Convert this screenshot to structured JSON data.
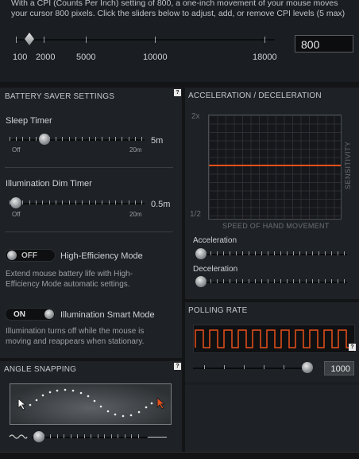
{
  "cpi": {
    "description": "With a CPI (Counts Per Inch) setting of 800, a one-inch movement of your mouse moves your cursor 800 pixels. Click the sliders below to adjust, add, or remove CPI levels (5 max)",
    "value": "800",
    "tick_labels": [
      "100",
      "2000",
      "5000",
      "10000",
      "18000"
    ]
  },
  "battery": {
    "header": "BATTERY SAVER SETTINGS",
    "help": "?",
    "sleep_label": "Sleep Timer",
    "sleep_value": "5m",
    "sleep_min": "Off",
    "sleep_max": "20m",
    "dim_label": "Illumination Dim Timer",
    "dim_value": "0.5m",
    "dim_min": "Off",
    "dim_max": "20m",
    "he_toggle": "OFF",
    "he_label": "High-Efficiency Mode",
    "he_desc": "Extend mouse battery life with High-Efficiency Mode automatic settings.",
    "smart_toggle": "ON",
    "smart_label": "Illumination Smart Mode",
    "smart_desc": "Illumination turns off while the mouse is moving and reappears when stationary."
  },
  "accel": {
    "header": "ACCELERATION / DECELERATION",
    "y_top": "2x",
    "y_bottom": "1/2",
    "y_axis": "SENSITIVITY",
    "x_axis": "SPEED OF HAND MOVEMENT",
    "accel_label": "Acceleration",
    "decel_label": "Deceleration",
    "line_color": "#e8501a"
  },
  "polling": {
    "header": "POLLING RATE",
    "help": "?",
    "value": "1000",
    "wave_color": "#e8501a"
  },
  "angle": {
    "header": "ANGLE SNAPPING",
    "help": "?"
  }
}
